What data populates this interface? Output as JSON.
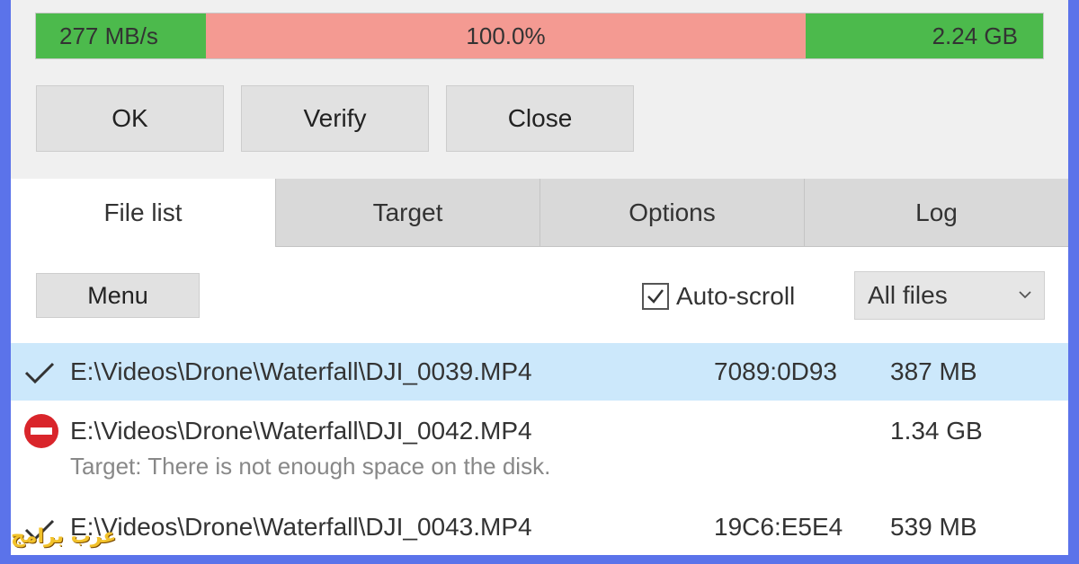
{
  "progress": {
    "speed": "277 MB/s",
    "percent": "100.0%",
    "size": "2.24 GB",
    "fraction": 1.0,
    "colors": {
      "speed": "#4cba4c",
      "percent": "#f49a92",
      "size": "#4cba4c"
    }
  },
  "actions": {
    "ok": "OK",
    "verify": "Verify",
    "close": "Close"
  },
  "tabs": [
    {
      "label": "File list",
      "active": true
    },
    {
      "label": "Target",
      "active": false
    },
    {
      "label": "Options",
      "active": false
    },
    {
      "label": "Log",
      "active": false
    }
  ],
  "toolbar": {
    "menu": "Menu",
    "autoscroll_label": "Auto-scroll",
    "autoscroll_checked": true,
    "filter_selected": "All files"
  },
  "files": [
    {
      "status": "checkmark-icon",
      "path": "E:\\Videos\\Drone\\Waterfall\\DJI_0039.MP4",
      "hash": "7089:0D93",
      "size": "387 MB",
      "selected": true
    },
    {
      "status": "error-icon",
      "path": "E:\\Videos\\Drone\\Waterfall\\DJI_0042.MP4",
      "hash": "",
      "size": "1.34 GB",
      "error": "Target: There is not enough space on the disk."
    },
    {
      "status": "checkmark-icon",
      "path": "E:\\Videos\\Drone\\Waterfall\\DJI_0043.MP4",
      "hash": "19C6:E5E4",
      "size": "539 MB"
    }
  ],
  "watermark": "عرب برامج"
}
